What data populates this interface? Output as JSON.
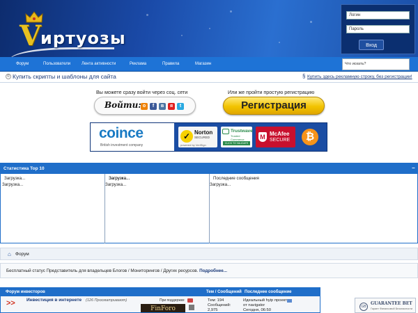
{
  "header": {
    "logo_letter": "V",
    "logo_text": "иртуозы",
    "login_placeholder": "Логин",
    "password_placeholder": "Пароль",
    "login_button": "Вход"
  },
  "nav": {
    "items": [
      "Форум",
      "Пользователи",
      "Лента активности",
      "Реклама",
      "Правила",
      "Магазин"
    ],
    "search_placeholder": "Что искать?"
  },
  "ads": {
    "left_text": "Купить скрипты и шаблоны для сайта",
    "right_text": "Купить здесь рекламную строку, без регистрации!"
  },
  "social": {
    "caption": "Вы можете сразу войти через соц. сети",
    "label": "Войти:",
    "networks": [
      "odnoklassniki-icon",
      "facebook-icon",
      "vk-icon",
      "yandex-icon",
      "twitter-icon"
    ]
  },
  "register": {
    "caption": "Или же пройти простую регистрацию",
    "button": "Регистрация"
  },
  "trust_banner": {
    "coince_name": "coince",
    "coince_tag": "British investment company",
    "norton_name": "Norton",
    "norton_sub": "SECURED",
    "norton_by": "powered by VeriSign",
    "trustwave_name": "Trustwave",
    "trustwave_sub": "Trusted Commerce",
    "trustwave_click": "CLICK TO VALIDATE",
    "mcafee_name": "McAfee",
    "mcafee_sub": "SECURE"
  },
  "stats": {
    "title": "Статистика Top 10",
    "toggle": "−",
    "columns": [
      {
        "title": "",
        "body": "Загрузка..."
      },
      {
        "title": "Загрузка...",
        "body": "Загрузка..."
      },
      {
        "title": "Загрузка...",
        "body": "Загрузка..."
      },
      {
        "title": "Последние сообщения",
        "body": "Загрузка..."
      }
    ]
  },
  "breadcrumb": {
    "label": "Форум"
  },
  "notice": {
    "text": "Бесплатный статус Представитель для владельцев Блогов / Мониторингов / Других ресурсов.",
    "more": "Подробнее..."
  },
  "forum": {
    "head_forum": "Форум инвесторов",
    "head_topics": "Тем / Сообщений",
    "head_last": "Последнее сообщение",
    "row": {
      "title": "Инвестиция в интернете",
      "views": "(126 Просматривают)",
      "sponsor": "При поддержке",
      "sponsor_name": "FinForo",
      "topics_label": "Тем:",
      "topics": "194",
      "posts_label": "Сообщений:",
      "posts": "2,975",
      "last_title": "Идеальный hyip проект",
      "last_by": "от navigator",
      "last_time": "Сегодня, 06:50"
    }
  },
  "side_ad": {
    "name": "GUARANTEE BET",
    "sub": "Гарант Финансовой Безопасности"
  }
}
